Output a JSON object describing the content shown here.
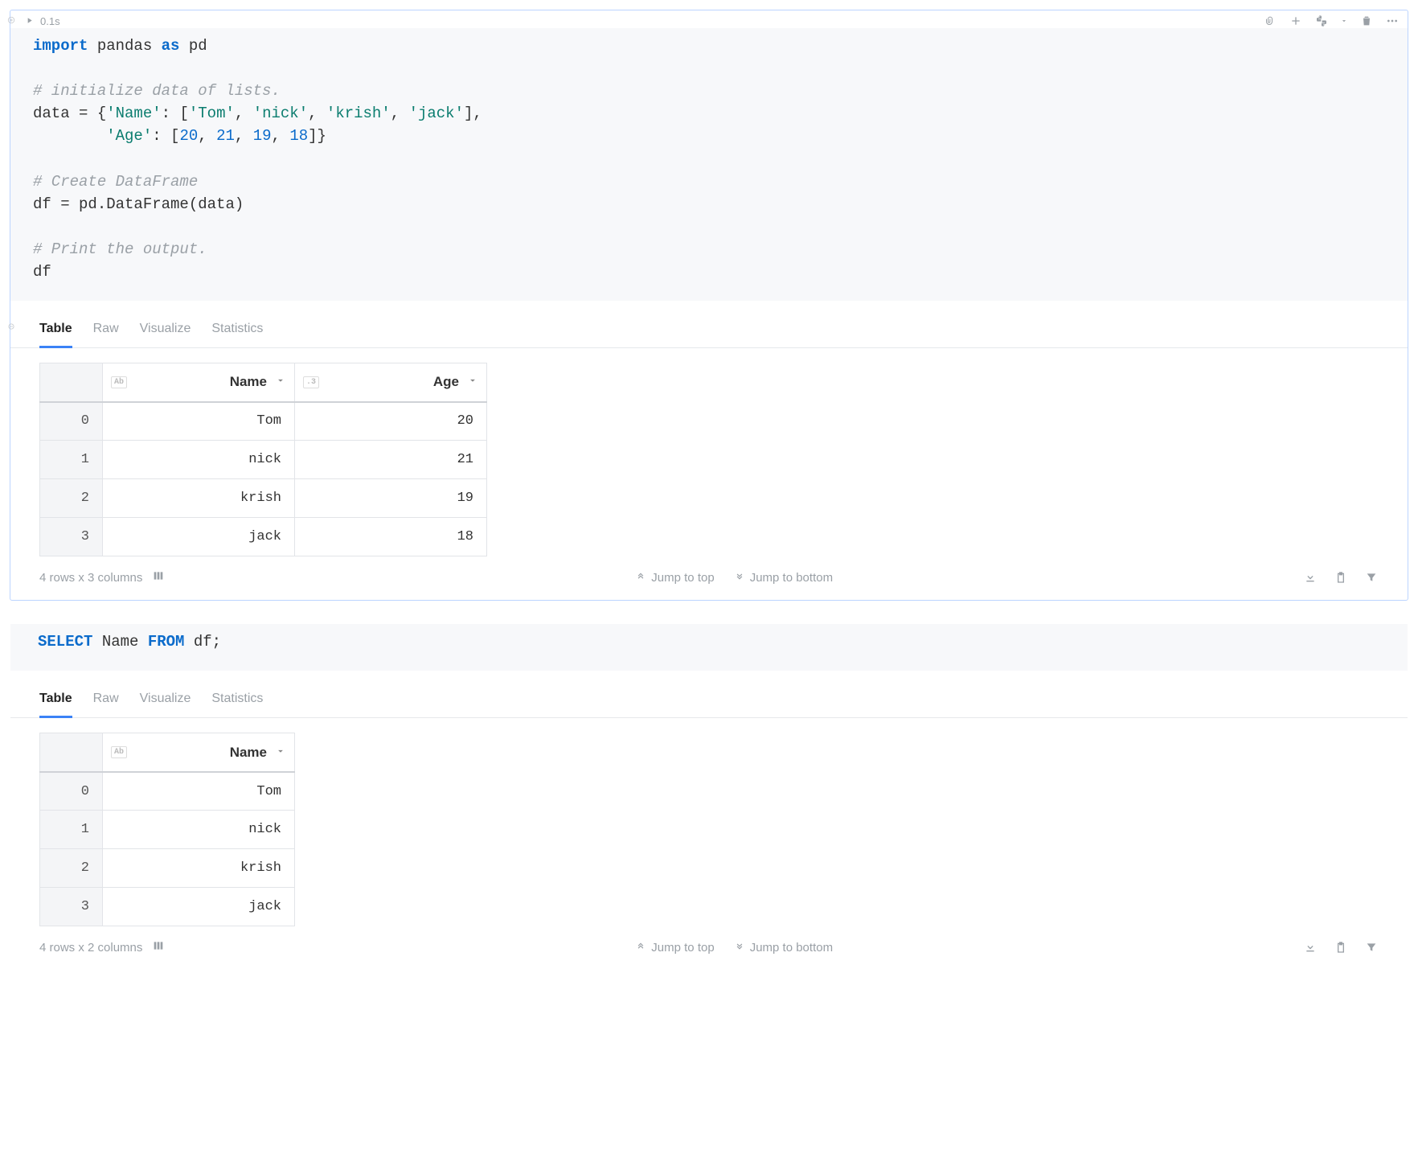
{
  "cell1": {
    "exec_time": "0.1s",
    "code": {
      "l1a": "import",
      "l1b": "pandas",
      "l1c": "as",
      "l1d": "pd",
      "l3": "# initialize data of lists.",
      "l4a": "data = {",
      "l4b": "'Name'",
      "l4c": ": [",
      "l4d": "'Tom'",
      "l4e": ", ",
      "l4f": "'nick'",
      "l4g": ", ",
      "l4h": "'krish'",
      "l4i": ", ",
      "l4j": "'jack'",
      "l4k": "],",
      "l5a": "        ",
      "l5b": "'Age'",
      "l5c": ": [",
      "l5d": "20",
      "l5e": ", ",
      "l5f": "21",
      "l5g": ", ",
      "l5h": "19",
      "l5i": ", ",
      "l5j": "18",
      "l5k": "]}",
      "l7": "# Create DataFrame",
      "l8": "df = pd.DataFrame(data)",
      "l10": "# Print the output.",
      "l11": "df"
    },
    "tabs": [
      "Table",
      "Raw",
      "Visualize",
      "Statistics"
    ],
    "columns": [
      {
        "type_tag": "Ab",
        "name": "Name"
      },
      {
        "type_tag": ".3",
        "name": "Age"
      }
    ],
    "rows": [
      {
        "idx": "0",
        "name": "Tom",
        "age": "20"
      },
      {
        "idx": "1",
        "name": "nick",
        "age": "21"
      },
      {
        "idx": "2",
        "name": "krish",
        "age": "19"
      },
      {
        "idx": "3",
        "name": "jack",
        "age": "18"
      }
    ],
    "footer": "4 rows x 3 columns",
    "jump_top": "Jump to top",
    "jump_bottom": "Jump to bottom"
  },
  "cell2": {
    "code": {
      "l1a": "SELECT",
      "l1b": " Name ",
      "l1c": "FROM",
      "l1d": " df;"
    },
    "tabs": [
      "Table",
      "Raw",
      "Visualize",
      "Statistics"
    ],
    "columns": [
      {
        "type_tag": "Ab",
        "name": "Name"
      }
    ],
    "rows": [
      {
        "idx": "0",
        "name": "Tom"
      },
      {
        "idx": "1",
        "name": "nick"
      },
      {
        "idx": "2",
        "name": "krish"
      },
      {
        "idx": "3",
        "name": "jack"
      }
    ],
    "footer": "4 rows x 2 columns",
    "jump_top": "Jump to top",
    "jump_bottom": "Jump to bottom"
  }
}
